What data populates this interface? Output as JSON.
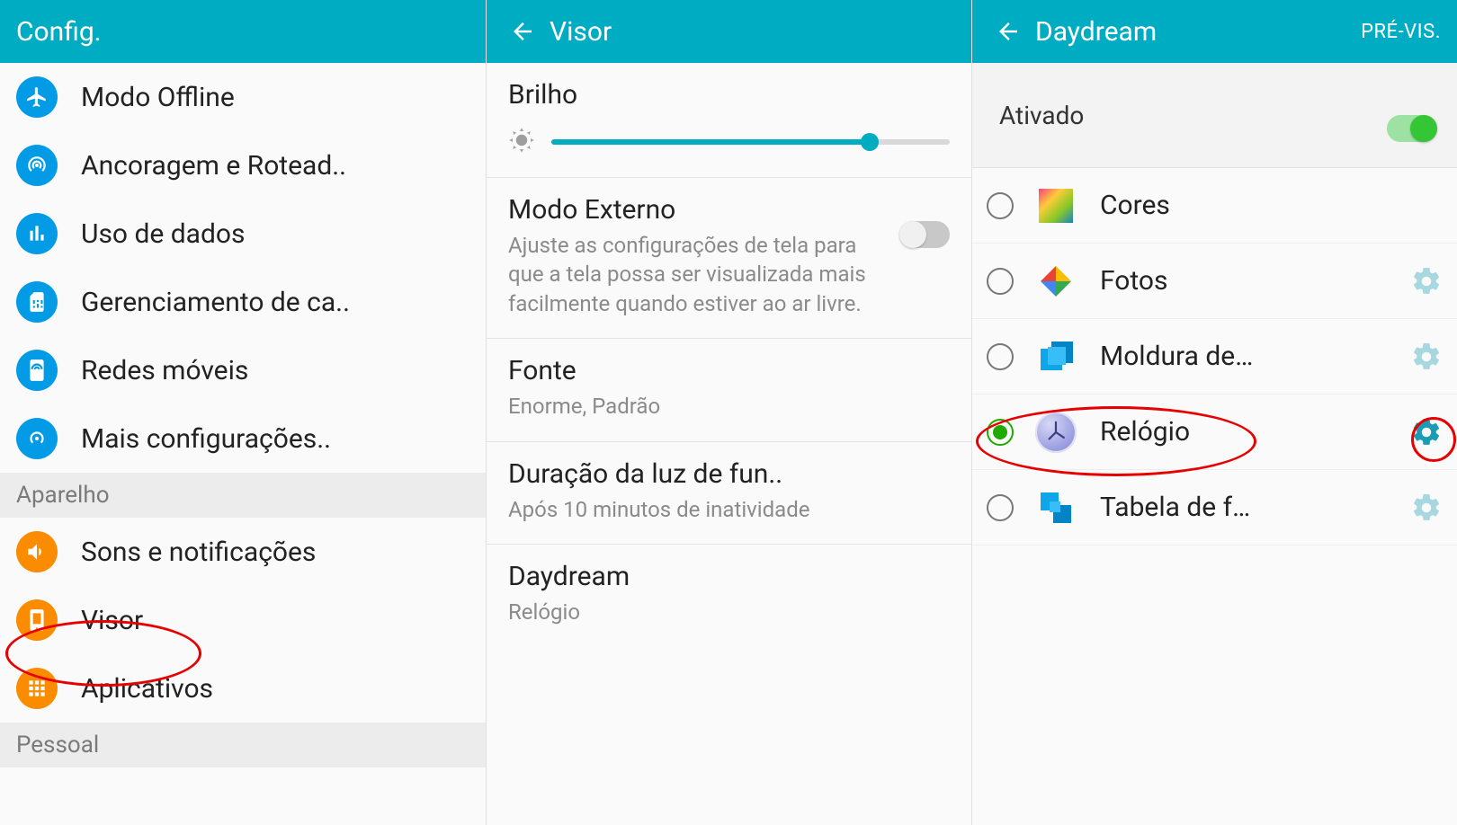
{
  "panel1": {
    "title": "Config.",
    "items_top": [
      {
        "label": "Modo Offline",
        "icon": "airplane"
      },
      {
        "label": "Ancoragem e Rotead..",
        "icon": "hotspot"
      },
      {
        "label": "Uso de dados",
        "icon": "bar"
      },
      {
        "label": "Gerenciamento de ca..",
        "icon": "sim"
      },
      {
        "label": "Redes móveis",
        "icon": "mobile"
      },
      {
        "label": "Mais configurações..",
        "icon": "more"
      }
    ],
    "section1": "Aparelho",
    "items_mid": [
      {
        "label": "Sons e notificações",
        "icon": "sound"
      },
      {
        "label": "Visor",
        "icon": "display"
      },
      {
        "label": "Aplicativos",
        "icon": "apps"
      }
    ],
    "section2": "Pessoal"
  },
  "panel2": {
    "title": "Visor",
    "brightness_label": "Brilho",
    "brightness_pct": 80,
    "outdoor_title": "Modo Externo",
    "outdoor_desc": "Ajuste as configurações de tela para que a tela possa ser visualizada mais facilmente quando estiver ao ar livre.",
    "font_title": "Fonte",
    "font_sub": "Enorme, Padrão",
    "backlight_title": "Duração da luz de fun..",
    "backlight_sub": "Após 10 minutos de inatividade",
    "daydream_title": "Daydream",
    "daydream_sub": "Relógio"
  },
  "panel3": {
    "title": "Daydream",
    "action": "PRÉ-VIS.",
    "status": "Ativado",
    "items": [
      {
        "label": "Cores",
        "icon": "colors",
        "gear": false
      },
      {
        "label": "Fotos",
        "icon": "photos",
        "gear": true
      },
      {
        "label": "Moldura de…",
        "icon": "frame",
        "gear": true
      },
      {
        "label": "Relógio",
        "icon": "clock",
        "gear": true,
        "selected": true
      },
      {
        "label": "Tabela de f…",
        "icon": "table",
        "gear": true
      }
    ]
  }
}
